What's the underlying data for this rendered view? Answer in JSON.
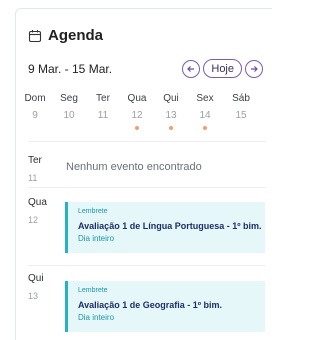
{
  "header": {
    "title": "Agenda",
    "icon": "calendar-icon"
  },
  "range": {
    "label": "9 Mar. - 15 Mar.",
    "prev_icon": "arrow-left-icon",
    "today_label": "Hoje",
    "next_icon": "arrow-right-icon"
  },
  "week": {
    "days": [
      {
        "name": "Dom",
        "num": "9",
        "has_event": false
      },
      {
        "name": "Seg",
        "num": "10",
        "has_event": false
      },
      {
        "name": "Ter",
        "num": "11",
        "has_event": false
      },
      {
        "name": "Qua",
        "num": "12",
        "has_event": true
      },
      {
        "name": "Qui",
        "num": "13",
        "has_event": true
      },
      {
        "name": "Sex",
        "num": "14",
        "has_event": true
      },
      {
        "name": "Sáb",
        "num": "15",
        "has_event": false
      }
    ]
  },
  "agenda": {
    "ter": {
      "name": "Ter",
      "num": "11",
      "empty_text": "Nenhum evento encontrado"
    },
    "qua": {
      "name": "Qua",
      "num": "12",
      "event": {
        "type": "Lembrete",
        "title": "Avaliação 1 de Língua Portuguesa - 1º bim.",
        "when": "Dia inteiro"
      }
    },
    "qui": {
      "name": "Qui",
      "num": "13",
      "event": {
        "type": "Lembrete",
        "title": "Avaliação 1 de Geografia - 1º bim.",
        "when": "Dia inteiro"
      }
    }
  },
  "colors": {
    "accent": "#7a5bb8",
    "event_bg": "#e6f7fa",
    "event_border": "#22b3c7",
    "dot": "#f4a06b"
  }
}
